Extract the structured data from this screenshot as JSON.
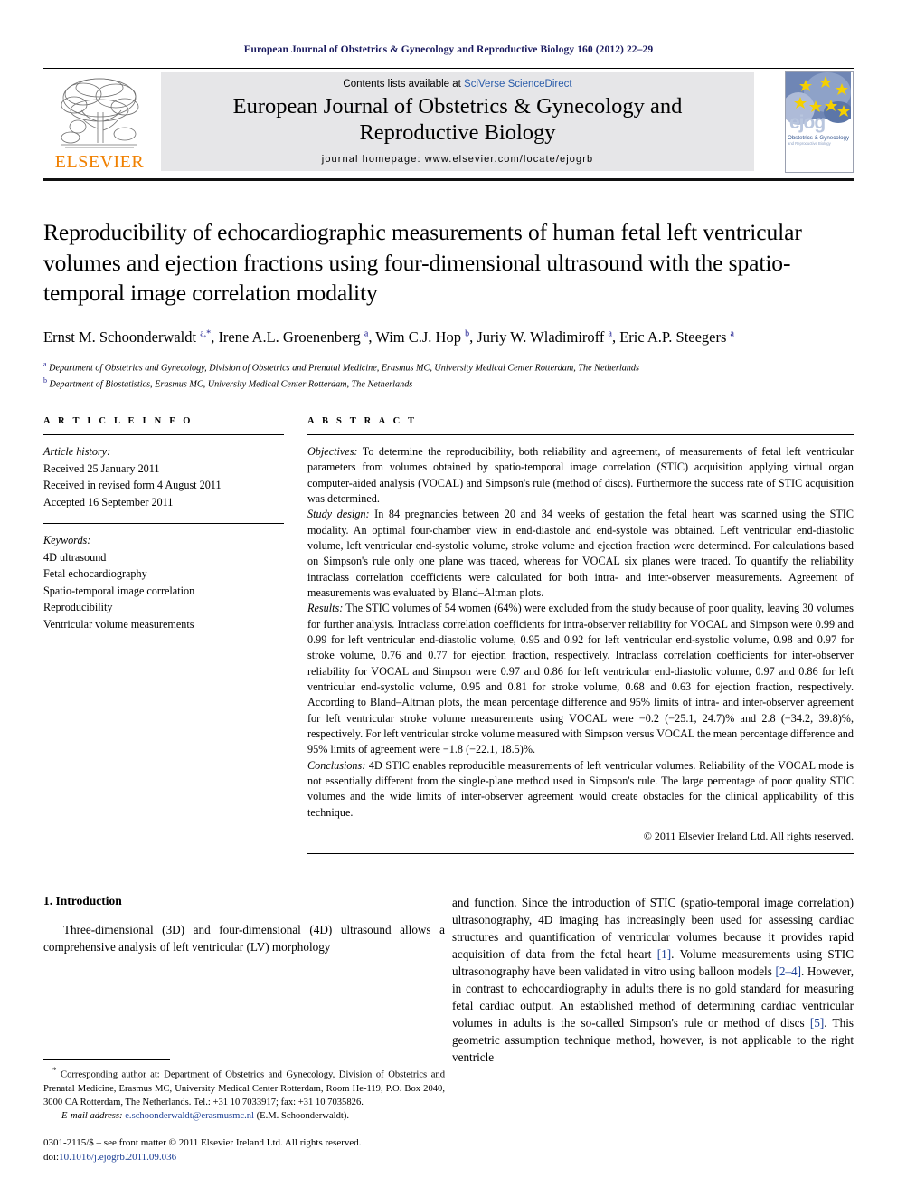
{
  "running_head": "European Journal of Obstetrics & Gynecology and Reproductive Biology 160 (2012) 22–29",
  "masthead": {
    "publisher_logo_text": "ELSEVIER",
    "contents_prefix": "Contents lists available at ",
    "contents_link": "SciVerse ScienceDirect",
    "journal_title_line1": "European Journal of Obstetrics & Gynecology and",
    "journal_title_line2": "Reproductive Biology",
    "homepage": "journal homepage: www.elsevier.com/locate/ejogrb",
    "cover_badge": "ejog",
    "cover_subtitle_line1": "Obstetrics & Gynecology",
    "cover_subtitle_line2": "and Reproductive Biology",
    "link_color": "#2a5caa",
    "elsevier_orange": "#F08000"
  },
  "article": {
    "title": "Reproducibility of echocardiographic measurements of human fetal left ventricular volumes and ejection fractions using four-dimensional ultrasound with the spatio-temporal image correlation modality",
    "authors_html": "Ernst M. Schoonderwaldt <sup>a,*</sup>, Irene A.L. Groenenberg <sup>a</sup>, Wim C.J. Hop <sup>b</sup>, Juriy W. Wladimiroff <sup>a</sup>, Eric A.P. Steegers <sup>a</sup>",
    "affiliation_a": "Department of Obstetrics and Gynecology, Division of Obstetrics and Prenatal Medicine, Erasmus MC, University Medical Center Rotterdam, The Netherlands",
    "affiliation_b": "Department of Biostatistics, Erasmus MC, University Medical Center Rotterdam, The Netherlands"
  },
  "article_info": {
    "heading": "A R T I C L E   I N F O",
    "history_label": "Article history:",
    "received": "Received 25 January 2011",
    "revised": "Received in revised form 4 August 2011",
    "accepted": "Accepted 16 September 2011",
    "keywords_label": "Keywords:",
    "keywords": [
      "4D ultrasound",
      "Fetal echocardiography",
      "Spatio-temporal image correlation",
      "Reproducibility",
      "Ventricular volume measurements"
    ]
  },
  "abstract": {
    "heading": "A B S T R A C T",
    "objectives_label": "Objectives:",
    "objectives_text": " To determine the reproducibility, both reliability and agreement, of measurements of fetal left ventricular parameters from volumes obtained by spatio-temporal image correlation (STIC) acquisition applying virtual organ computer-aided analysis (VOCAL) and Simpson's rule (method of discs). Furthermore the success rate of STIC acquisition was determined.",
    "study_design_label": "Study design:",
    "study_design_text": " In 84 pregnancies between 20 and 34 weeks of gestation the fetal heart was scanned using the STIC modality. An optimal four-chamber view in end-diastole and end-systole was obtained. Left ventricular end-diastolic volume, left ventricular end-systolic volume, stroke volume and ejection fraction were determined. For calculations based on Simpson's rule only one plane was traced, whereas for VOCAL six planes were traced. To quantify the reliability intraclass correlation coefficients were calculated for both intra- and inter-observer measurements. Agreement of measurements was evaluated by Bland–Altman plots.",
    "results_label": "Results:",
    "results_text": " The STIC volumes of 54 women (64%) were excluded from the study because of poor quality, leaving 30 volumes for further analysis. Intraclass correlation coefficients for intra-observer reliability for VOCAL and Simpson were 0.99 and 0.99 for left ventricular end-diastolic volume, 0.95 and 0.92 for left ventricular end-systolic volume, 0.98 and 0.97 for stroke volume, 0.76 and 0.77 for ejection fraction, respectively. Intraclass correlation coefficients for inter-observer reliability for VOCAL and Simpson were 0.97 and 0.86 for left ventricular end-diastolic volume, 0.97 and 0.86 for left ventricular end-systolic volume, 0.95 and 0.81 for stroke volume, 0.68 and 0.63 for ejection fraction, respectively. According to Bland–Altman plots, the mean percentage difference and 95% limits of intra- and inter-observer agreement for left ventricular stroke volume measurements using VOCAL were −0.2 (−25.1, 24.7)% and 2.8 (−34.2, 39.8)%, respectively. For left ventricular stroke volume measured with Simpson versus VOCAL the mean percentage difference and 95% limits of agreement were −1.8 (−22.1, 18.5)%.",
    "conclusions_label": "Conclusions:",
    "conclusions_text": " 4D STIC enables reproducible measurements of left ventricular volumes. Reliability of the VOCAL mode is not essentially different from the single-plane method used in Simpson's rule. The large percentage of poor quality STIC volumes and the wide limits of inter-observer agreement would create obstacles for the clinical applicability of this technique.",
    "copyright": "© 2011 Elsevier Ireland Ltd. All rights reserved."
  },
  "introduction": {
    "heading": "1. Introduction",
    "left_paragraph": "Three-dimensional (3D) and four-dimensional (4D) ultrasound allows a comprehensive analysis of left ventricular (LV) morphology",
    "right_paragraph_part1": "and function. Since the introduction of STIC (spatio-temporal image correlation) ultrasonography, 4D imaging has increasingly been used for assessing cardiac structures and quantification of ventricular volumes because it provides rapid acquisition of data from the fetal heart ",
    "ref1": "[1]",
    "right_paragraph_part2": ". Volume measurements using STIC ultrasonography have been validated in vitro using balloon models ",
    "ref2": "[2–4]",
    "right_paragraph_part3": ". However, in contrast to echocardiography in adults there is no gold standard for measuring fetal cardiac output. An established method of determining cardiac ventricular volumes in adults is the so-called Simpson's rule or method of discs ",
    "ref3": "[5]",
    "right_paragraph_part4": ". This geometric assumption technique method, however, is not applicable to the right ventricle"
  },
  "footnote": {
    "star": "*",
    "corresponding_text": " Corresponding author at: Department of Obstetrics and Gynecology, Division of Obstetrics and Prenatal Medicine, Erasmus MC, University Medical Center Rotterdam, Room He-119, P.O. Box 2040, 3000 CA Rotterdam, The Netherlands. Tel.: +31 10 7033917; fax: +31 10 7035826.",
    "email_label": "E-mail address:",
    "email": "e.schoonderwaldt@erasmusmc.nl",
    "email_suffix": " (E.M. Schoonderwaldt).",
    "frontmatter": "0301-2115/$ – see front matter © 2011 Elsevier Ireland Ltd. All rights reserved.",
    "doi_label": "doi:",
    "doi": "10.1016/j.ejogrb.2011.09.036"
  }
}
